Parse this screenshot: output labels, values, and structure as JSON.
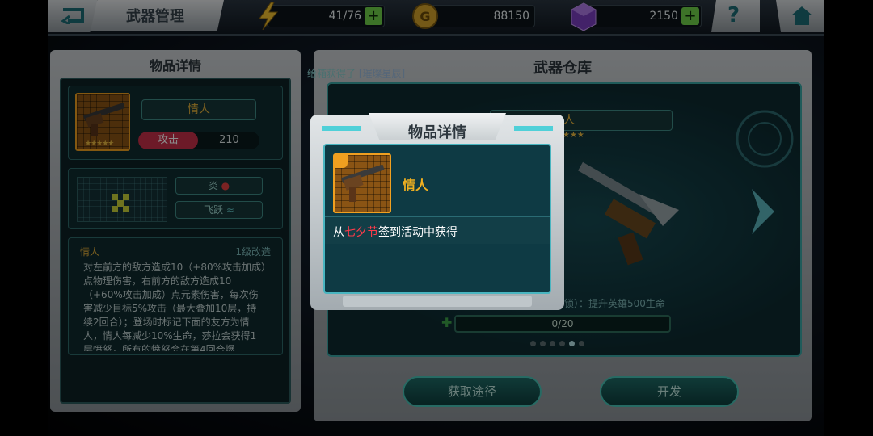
{
  "header": {
    "title": "武器管理",
    "energy": "41/76",
    "gold": "88150",
    "gems": "2150",
    "help_label": "?"
  },
  "left_panel": {
    "title": "物品详情",
    "item_name": "情人",
    "attack_label": "攻击",
    "attack_value": "210",
    "element_1": "炎",
    "element_2": "飞跃",
    "desc_name": "情人",
    "desc_level": "1级改造",
    "description": "对左前方的敌方造成10（+80%攻击加成）点物理伤害，右前方的敌方造成10（+60%攻击加成）点元素伤害，每次伤害减少目标5%攻击（最大叠加10层，持续2回合）；登场时标记下面的友方为情人，情人每减少10%生命，莎拉会获得1层愤怒，所有的愤怒会在第4回合爆"
  },
  "right_panel": {
    "title": "武器仓库",
    "notice_prefix": "给箱获得了",
    "notice_item": "[璀璨星辰]",
    "item_name_partial": "人",
    "skill_text": "解锁）：提升英雄500生命",
    "progress": "0/20",
    "progress_fraction": 0.0,
    "page_dots": 6,
    "page_active": 5,
    "btn_obtain": "获取途径",
    "btn_develop": "开发"
  },
  "modal": {
    "title": "物品详情",
    "item_name": "情人",
    "source_pre": "从",
    "source_highlight": "七夕节",
    "source_post": "签到活动中获得"
  },
  "colors": {
    "accent_teal": "#49b5c0",
    "item_gold": "#f0b020",
    "highlight_red": "#ff3b4a",
    "plus_green": "#6fd14a"
  }
}
